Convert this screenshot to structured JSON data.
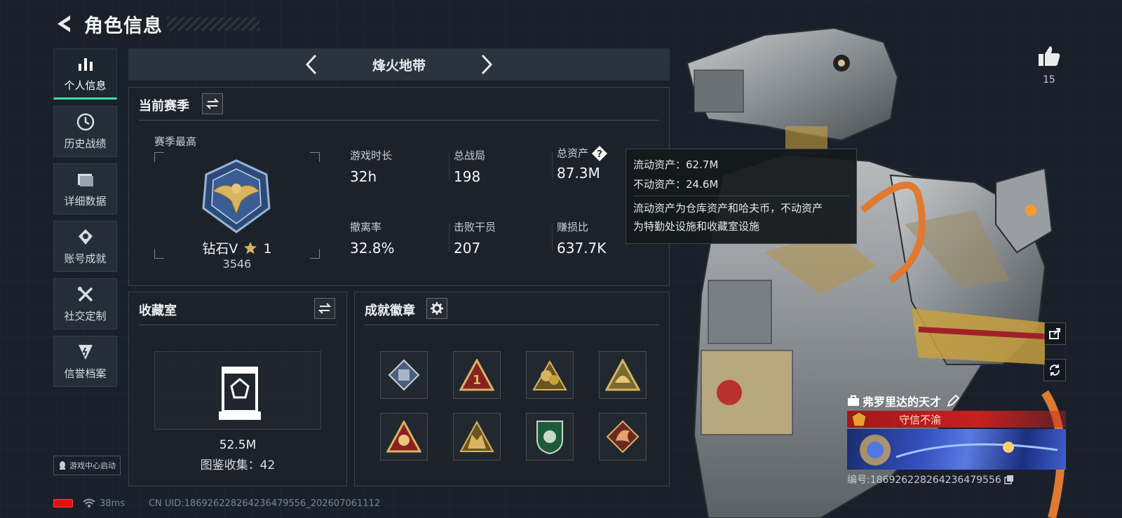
{
  "header": {
    "title": "角色信息"
  },
  "sidenav": {
    "items": [
      {
        "label": "个人信息",
        "icon": "bar-chart-icon",
        "active": true
      },
      {
        "label": "历史战绩",
        "icon": "clock-icon"
      },
      {
        "label": "详细数据",
        "icon": "folder-icon"
      },
      {
        "label": "账号成就",
        "icon": "medal-icon"
      },
      {
        "label": "社交定制",
        "icon": "tools-icon"
      },
      {
        "label": "信誉档案",
        "icon": "shield-icon"
      }
    ]
  },
  "launch_badge": "游戏中心启动",
  "status": {
    "ping": "38ms",
    "uid": "CN UID:18692622826423647955​6_202607061112"
  },
  "mode": {
    "title": "烽火地带"
  },
  "season": {
    "title": "当前赛季",
    "best_label": "赛季最高",
    "rank_name": "钻石V",
    "rank_stars": "1",
    "rank_score": "3546",
    "stats": [
      {
        "label": "游戏时长",
        "value": "32h"
      },
      {
        "label": "总战局",
        "value": "198"
      },
      {
        "label": "总资产",
        "value": "87.3M"
      },
      {
        "label": "撤离率",
        "value": "32.8%"
      },
      {
        "label": "击败干员",
        "value": "207"
      },
      {
        "label": "赚损比",
        "value": "637.7K"
      }
    ]
  },
  "tooltip": {
    "liquid": "流动资产：62.7M",
    "fixed": "不动资产：24.6M",
    "desc1": "流动资产为仓库资产和哈夫币，不动资产",
    "desc2": "为特勤处设施和收藏室设施"
  },
  "collection": {
    "title": "收藏室",
    "value": "52.5M",
    "count": "图鉴收集：42"
  },
  "badges": {
    "title": "成就徽章",
    "slots": 8
  },
  "like": {
    "count": "15"
  },
  "player": {
    "name": "弗罗里达的天才",
    "title": "守信不渝",
    "id": "编号:18692622826423647955​6"
  },
  "colors": {
    "accent": "#3de0a0",
    "title_bar": "#c62020",
    "battery": "#e01010"
  }
}
